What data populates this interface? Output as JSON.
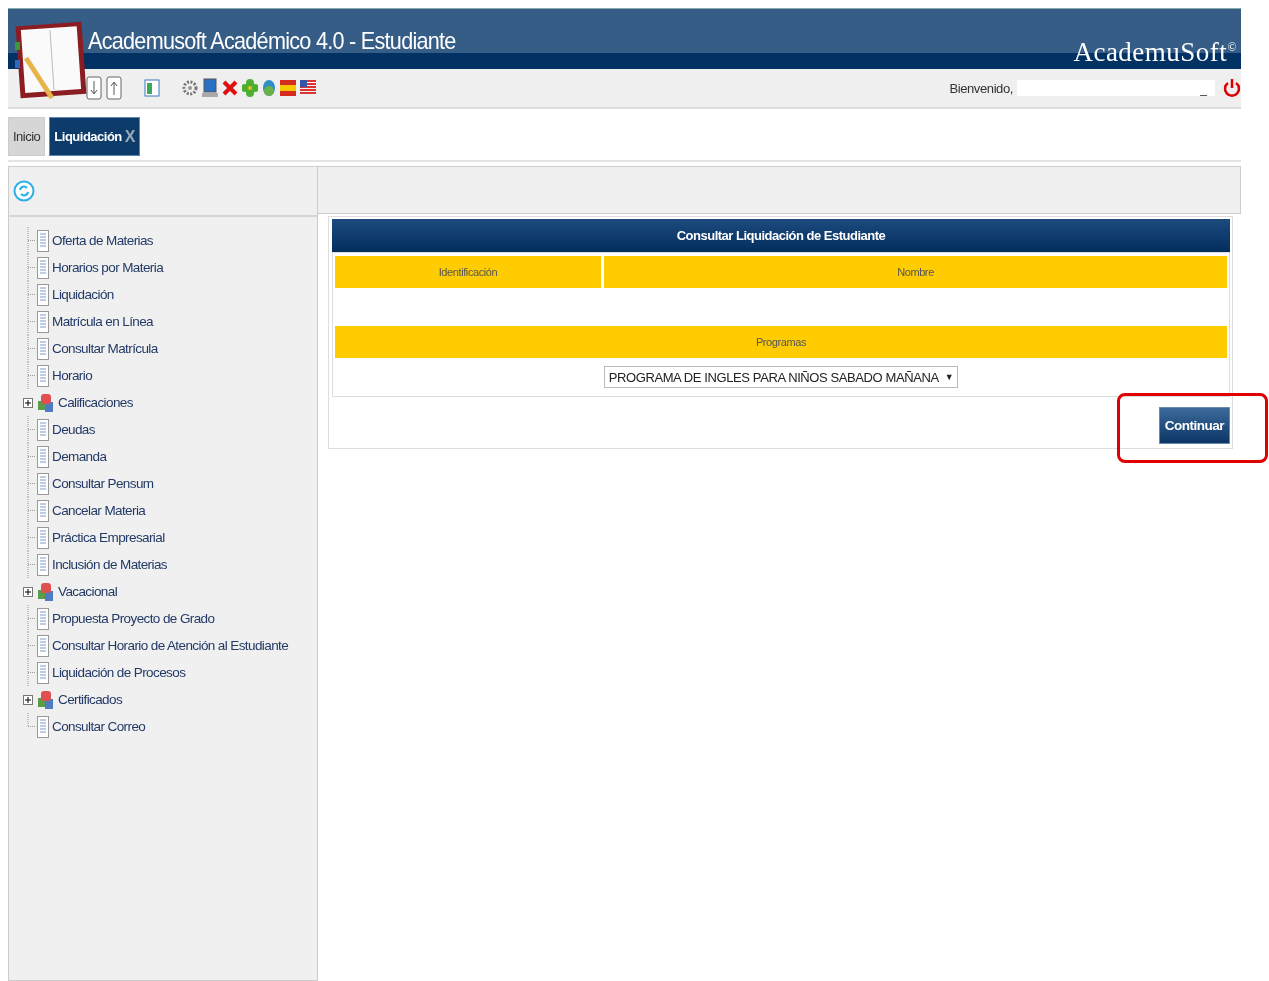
{
  "header": {
    "title": "Academusoft Académico 4.0 - Estudiante",
    "brand": "AcademuSoft",
    "brand_mark": "©"
  },
  "toolbar": {
    "welcome": "Bienvenido,",
    "user": "_"
  },
  "tabs": [
    {
      "label": "Inicio",
      "selected": false
    },
    {
      "label": "Liquidación",
      "selected": true,
      "close": "X"
    }
  ],
  "sidebar": {
    "items": [
      {
        "label": "Oferta de Materias",
        "kind": "page"
      },
      {
        "label": "Horarios por Materia",
        "kind": "page"
      },
      {
        "label": "Liquidación",
        "kind": "page"
      },
      {
        "label": "Matrícula en Línea",
        "kind": "page"
      },
      {
        "label": "Consultar Matrícula",
        "kind": "page"
      },
      {
        "label": "Horario",
        "kind": "page"
      },
      {
        "label": "Calificaciones",
        "kind": "folder",
        "expanded": false
      },
      {
        "label": "Deudas",
        "kind": "page"
      },
      {
        "label": "Demanda",
        "kind": "page"
      },
      {
        "label": "Consultar Pensum",
        "kind": "page"
      },
      {
        "label": "Cancelar Materia",
        "kind": "page"
      },
      {
        "label": "Práctica Empresarial",
        "kind": "page"
      },
      {
        "label": "Inclusión de Materias",
        "kind": "page"
      },
      {
        "label": "Vacacional",
        "kind": "folder",
        "expanded": false
      },
      {
        "label": "Propuesta Proyecto de Grado",
        "kind": "page"
      },
      {
        "label": "Consultar Horario de Atención al Estudiante",
        "kind": "page"
      },
      {
        "label": "Liquidación de Procesos",
        "kind": "page"
      },
      {
        "label": "Certificados",
        "kind": "folder",
        "expanded": false
      },
      {
        "label": "Consultar Correo",
        "kind": "page"
      }
    ]
  },
  "form": {
    "title": "Consultar Liquidación de Estudiante",
    "columns": [
      "Identificación",
      "Nombre"
    ],
    "programs_label": "Programas",
    "program": "PROGRAMA DE INGLES PARA NIÑOS SABADO MAÑANA",
    "dropdown_arrow": "▼"
  },
  "continue_button": {
    "label": "Continuar",
    "highlighted": true
  }
}
